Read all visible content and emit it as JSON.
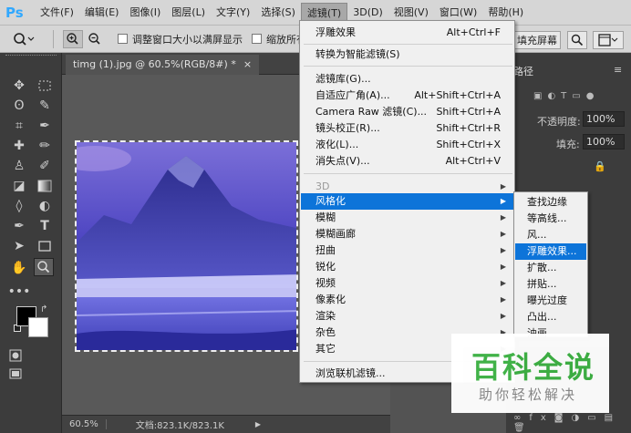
{
  "app": {
    "logo": "Ps"
  },
  "menubar": [
    {
      "label": "文件(F)"
    },
    {
      "label": "编辑(E)"
    },
    {
      "label": "图像(I)"
    },
    {
      "label": "图层(L)"
    },
    {
      "label": "文字(Y)"
    },
    {
      "label": "选择(S)"
    },
    {
      "label": "滤镜(T)"
    },
    {
      "label": "3D(D)"
    },
    {
      "label": "视图(V)"
    },
    {
      "label": "窗口(W)"
    },
    {
      "label": "帮助(H)"
    }
  ],
  "options_bar": {
    "checkbox_resize": "调整窗口大小以满屏显示",
    "checkbox_zoom_all": "缩放所有",
    "fill_screen": "填充屏幕"
  },
  "document": {
    "tab_title": "timg (1).jpg @ 60.5%(RGB/8#) *",
    "tab_close": "×",
    "zoom": "60.5%",
    "doc_info": "文档:823.1K/823.1K"
  },
  "filter_menu": {
    "items": [
      {
        "label": "浮雕效果",
        "shortcut": "Alt+Ctrl+F"
      },
      {
        "label": "转换为智能滤镜(S)",
        "shortcut": ""
      },
      {
        "label": "滤镜库(G)...",
        "shortcut": ""
      },
      {
        "label": "自适应广角(A)...",
        "shortcut": "Alt+Shift+Ctrl+A"
      },
      {
        "label": "Camera Raw 滤镜(C)...",
        "shortcut": "Shift+Ctrl+A"
      },
      {
        "label": "镜头校正(R)...",
        "shortcut": "Shift+Ctrl+R"
      },
      {
        "label": "液化(L)...",
        "shortcut": "Shift+Ctrl+X"
      },
      {
        "label": "消失点(V)...",
        "shortcut": "Alt+Ctrl+V"
      },
      {
        "label": "3D",
        "shortcut": ""
      },
      {
        "label": "风格化",
        "shortcut": ""
      },
      {
        "label": "模糊",
        "shortcut": ""
      },
      {
        "label": "模糊画廊",
        "shortcut": ""
      },
      {
        "label": "扭曲",
        "shortcut": ""
      },
      {
        "label": "锐化",
        "shortcut": ""
      },
      {
        "label": "视频",
        "shortcut": ""
      },
      {
        "label": "像素化",
        "shortcut": ""
      },
      {
        "label": "渲染",
        "shortcut": ""
      },
      {
        "label": "杂色",
        "shortcut": ""
      },
      {
        "label": "其它",
        "shortcut": ""
      },
      {
        "label": "浏览联机滤镜...",
        "shortcut": ""
      }
    ]
  },
  "stylize_submenu": [
    {
      "label": "查找边缘"
    },
    {
      "label": "等高线..."
    },
    {
      "label": "风..."
    },
    {
      "label": "浮雕效果..."
    },
    {
      "label": "扩散..."
    },
    {
      "label": "拼贴..."
    },
    {
      "label": "曝光过度"
    },
    {
      "label": "凸出..."
    },
    {
      "label": "油画"
    }
  ],
  "panels": {
    "tab_label": "路径",
    "opacity_label": "不透明度:",
    "opacity_value": "100%",
    "fill_label": "填充:",
    "fill_value": "100%"
  },
  "watermark": {
    "title": "百科全说",
    "subtitle": "助你轻松解决"
  },
  "colors": {
    "accent": "#0d74d9",
    "ps_blue": "#31a8ff",
    "watermark_green": "#3cb043"
  }
}
